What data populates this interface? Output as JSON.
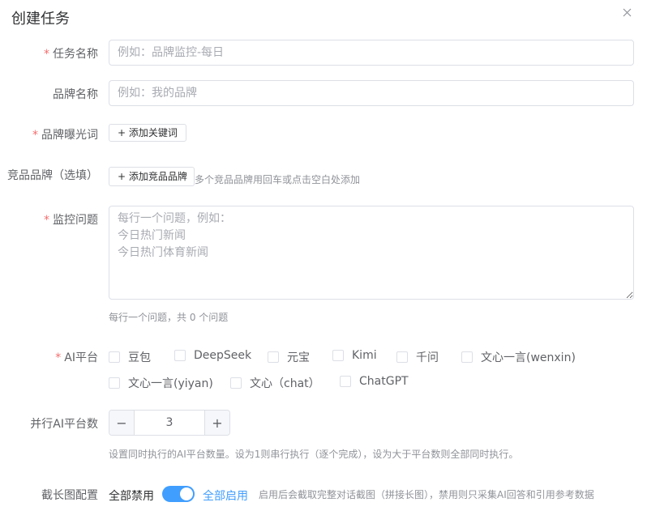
{
  "dialog": {
    "title": "创建任务"
  },
  "form": {
    "task_name": {
      "label": "任务名称",
      "required": true,
      "placeholder": "例如：品牌监控-每日"
    },
    "brand_name": {
      "label": "品牌名称",
      "required": false,
      "placeholder": "例如：我的品牌"
    },
    "brand_keywords": {
      "label": "品牌曝光词",
      "required": true,
      "button": "+ 添加关键词"
    },
    "competitors": {
      "label": "竞品品牌（选填）",
      "button": "+ 添加竞品品牌",
      "hint": "多个竞品品牌用回车或点击空白处添加"
    },
    "questions": {
      "label": "监控问题",
      "required": true,
      "placeholder": "每行一个问题，例如：\n今日热门新闻\n今日热门体育新闻",
      "hint": "每行一个问题，共 0 个问题"
    },
    "platforms": {
      "label": "AI平台",
      "required": true,
      "options": [
        "豆包",
        "DeepSeek",
        "元宝",
        "Kimi",
        "千问",
        "文心一言(wenxin)",
        "文心一言(yiyan)",
        "文心（chat）",
        "ChatGPT"
      ]
    },
    "parallel": {
      "label": "并行AI平台数",
      "value": "3",
      "minus": "−",
      "plus": "+",
      "hint": "设置同时执行的AI平台数量。设为1则串行执行（逐个完成），设为大于平台数则全部同时执行。"
    },
    "screenshot": {
      "label": "截长图配置",
      "off_text": "全部禁用",
      "on_text": "全部启用",
      "enabled": true,
      "hint": "启用后会截取完整对话截图（拼接长图），禁用则只采集AI回答和引用参考数据"
    }
  },
  "colors": {
    "primary": "#409eff",
    "required": "#f56c6c",
    "border": "#dcdfe6"
  }
}
